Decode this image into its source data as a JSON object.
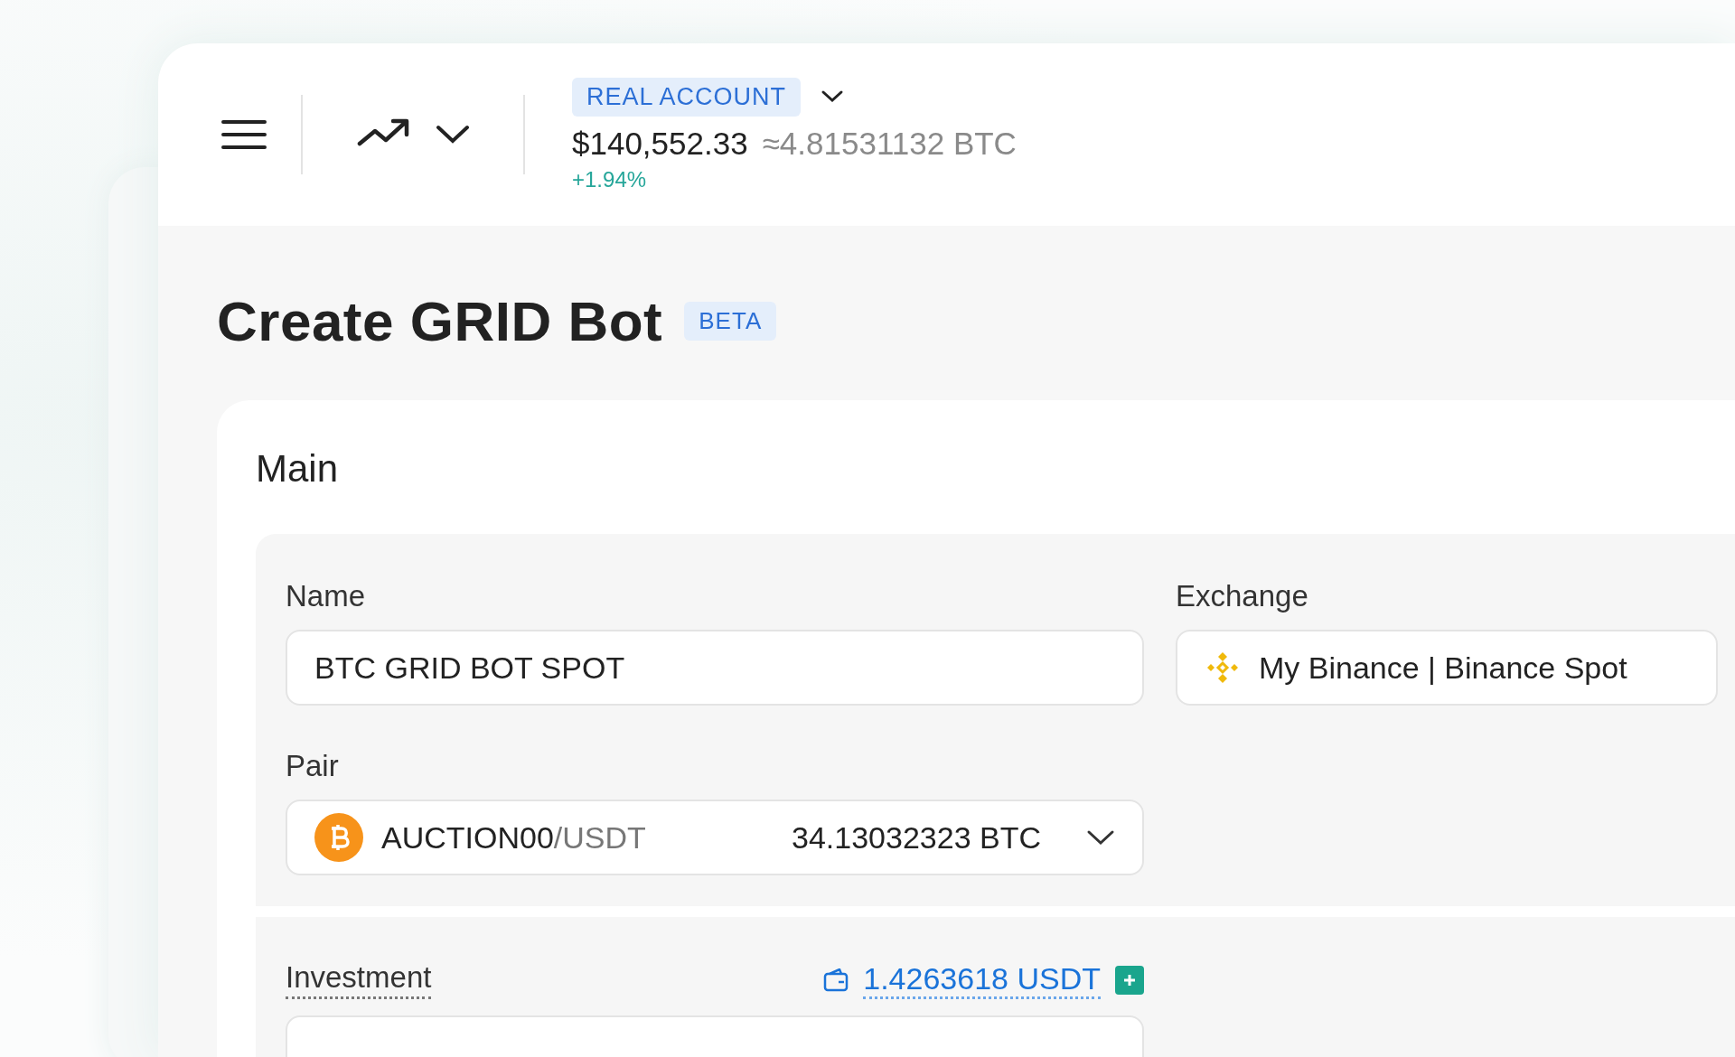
{
  "header": {
    "account_badge": "REAL ACCOUNT",
    "balance": "$140,552.33",
    "balance_btc": "≈4.81531132 BTC",
    "change": "+1.94%"
  },
  "page": {
    "title": "Create GRID Bot",
    "badge": "BETA"
  },
  "main": {
    "title": "Main",
    "name": {
      "label": "Name",
      "value": "BTC GRID BOT SPOT"
    },
    "exchange": {
      "label": "Exchange",
      "value": "My Binance | Binance Spot"
    },
    "pair": {
      "label": "Pair",
      "base": "AUCTION00",
      "quote": "/USDT",
      "balance": "34.13032323 BTC"
    },
    "investment": {
      "label": "Investment",
      "available": "1.4263618 USDT"
    }
  }
}
